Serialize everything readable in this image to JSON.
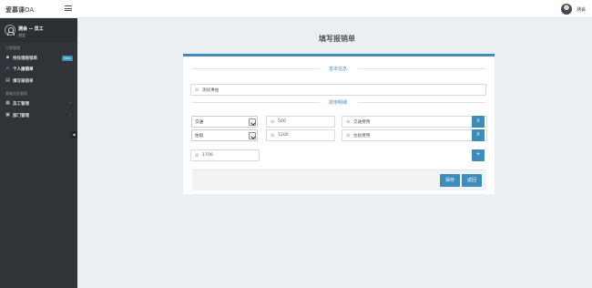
{
  "header": {
    "brand_main": "爱慕课",
    "brand_suffix": "OA",
    "menu_icon": "hamburger-icon",
    "user_name": "测会"
  },
  "sidebar": {
    "profile": {
      "name": "测会 -- 员工",
      "role": "测会"
    },
    "sections": [
      {
        "title": "日常管理"
      },
      {
        "title": "基础信息管理"
      }
    ],
    "items": [
      {
        "label": "待处理报销单",
        "icon": "file-icon",
        "badge": "New"
      },
      {
        "label": "个人报销单",
        "icon": "home-icon"
      },
      {
        "label": "填写报销单",
        "icon": "calendar-icon"
      },
      {
        "label": "员工管理",
        "icon": "user-icon"
      },
      {
        "label": "部门管理",
        "icon": "folder-icon"
      }
    ],
    "collapse_label": "◀"
  },
  "main": {
    "title": "填写报销单",
    "basic_legend": "基本信息",
    "detail_legend": "费用明细",
    "cause_value": "测试事由",
    "rows": [
      {
        "type": "交通",
        "amount": "500",
        "remark": "交通费用",
        "delete_label": "X"
      },
      {
        "type": "住宿",
        "amount": "1200",
        "remark": "住宿费用",
        "delete_label": "X"
      }
    ],
    "total": "1700",
    "add_label": "+",
    "save_label": "保存",
    "back_label": "返回"
  },
  "colors": {
    "accent": "#3c8dbc",
    "sidebar_bg": "#2f3438",
    "page_bg": "#eceff1"
  }
}
